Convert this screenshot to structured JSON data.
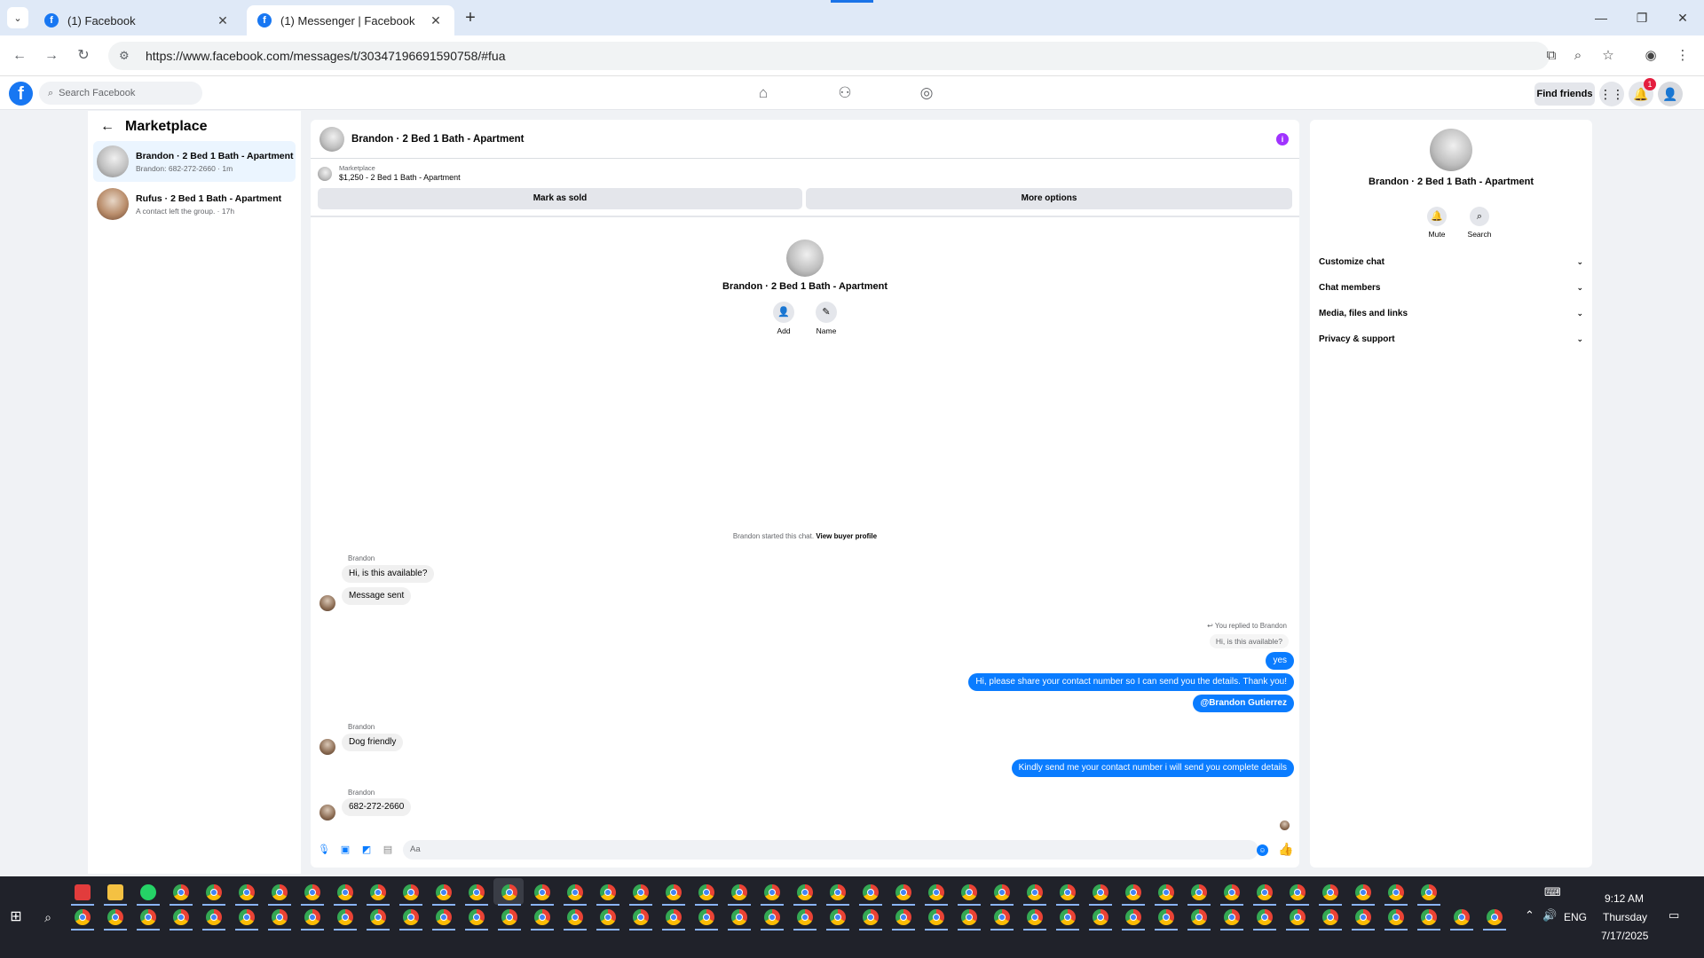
{
  "browser": {
    "tabs": [
      {
        "title": "(1) Facebook",
        "active": false
      },
      {
        "title": "(1) Messenger | Facebook",
        "active": true
      }
    ],
    "url": "https://www.facebook.com/messages/t/30347196691590758/#fua"
  },
  "fb_header": {
    "logo_letter": "f",
    "search_placeholder": "Search Facebook",
    "find_friends": "Find friends",
    "notification_count": "1"
  },
  "left_panel": {
    "title": "Marketplace",
    "conversations": [
      {
        "name": "Brandon · 2 Bed 1 Bath - Apartment",
        "subtitle": "Brandon: 682-272-2660 · 1m",
        "selected": true
      },
      {
        "name": "Rufus · 2 Bed 1 Bath - Apartment",
        "subtitle": "A contact left the group. · 17h",
        "selected": false
      }
    ]
  },
  "chat": {
    "header_title": "Brandon · 2 Bed 1 Bath - Apartment",
    "listing": {
      "kind": "Marketplace",
      "price_title": "$1,250 - 2 Bed 1 Bath - Apartment",
      "mark_sold": "Mark as sold",
      "more_options": "More options"
    },
    "center": {
      "name": "Brandon · 2 Bed 1 Bath - Apartment",
      "add_label": "Add",
      "name_label": "Name"
    },
    "started_text": "Brandon started this chat.",
    "view_buyer_profile": "View buyer profile",
    "sender_name": "Brandon",
    "messages": {
      "m1": "Hi, is this available?",
      "m2": "Message sent",
      "reply_note": "You replied to Brandon",
      "reply_quote": "Hi, is this available?",
      "m3": "yes",
      "m4": "Hi, please share your contact number so I can send you the details. Thank you!",
      "m5": "@Brandon Gutierrez",
      "m6": "Dog friendly",
      "m7": "Kindly send me your contact number i will send you complete details",
      "m8": "682-272-2660"
    },
    "composer_placeholder": "Aa"
  },
  "right_panel": {
    "name": "Brandon · 2 Bed 1 Bath - Apartment",
    "mute_label": "Mute",
    "search_label": "Search",
    "sections": [
      "Customize chat",
      "Chat members",
      "Media, files and links",
      "Privacy & support"
    ]
  },
  "taskbar": {
    "time": "9:12 AM",
    "day": "Thursday",
    "date": "7/17/2025",
    "language": "ENG"
  },
  "colors": {
    "brand_blue": "#1877f2",
    "messenger_blue": "#0a7cff",
    "info_purple": "#a033ff",
    "badge_red": "#e41e3f"
  }
}
